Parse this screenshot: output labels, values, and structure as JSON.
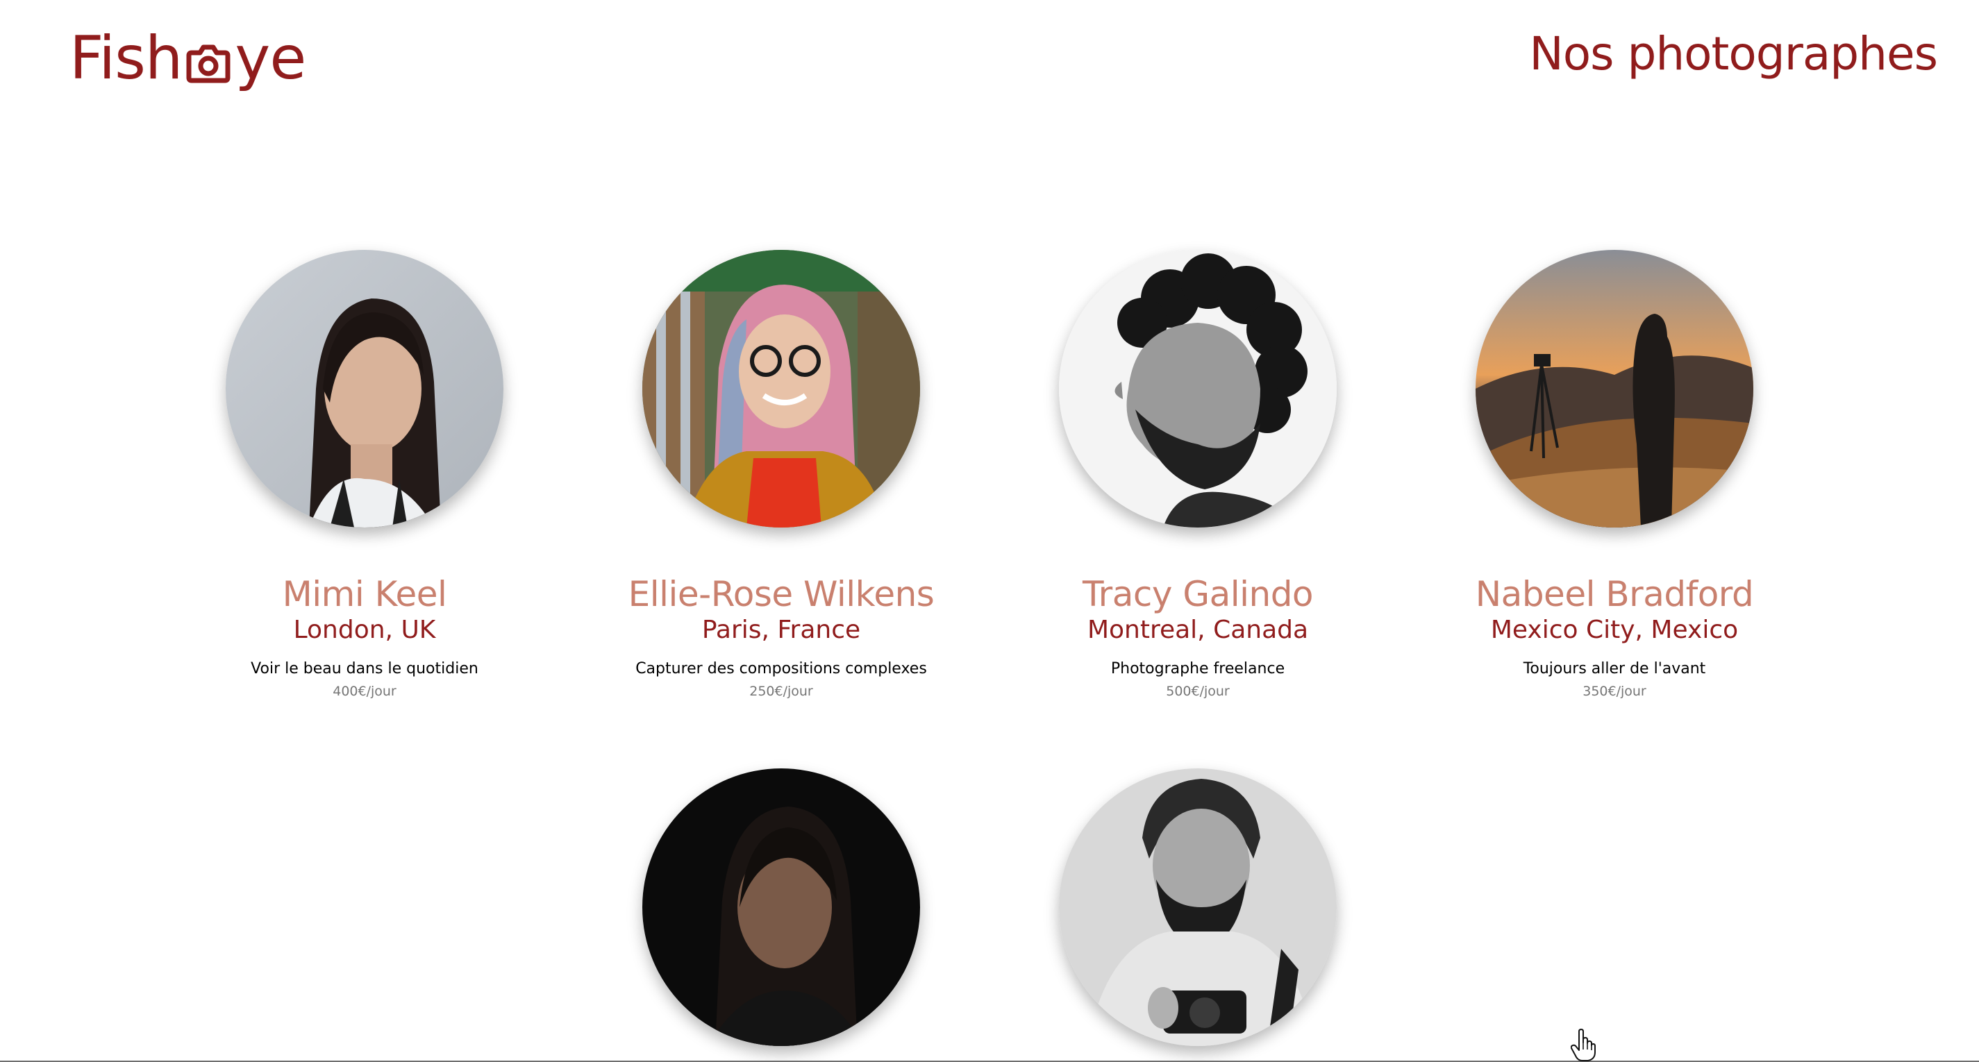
{
  "header": {
    "logo_left": "Fish",
    "logo_right": "ye",
    "logo_icon": "camera-icon",
    "title": "Nos photographes"
  },
  "photographers": [
    {
      "name": "Mimi Keel",
      "location": "London, UK",
      "tagline": "Voir le beau dans le quotidien",
      "price": "400€/jour",
      "portrait_icon": "portrait-photo"
    },
    {
      "name": "Ellie-Rose Wilkens",
      "location": "Paris, France",
      "tagline": "Capturer des compositions complexes",
      "price": "250€/jour",
      "portrait_icon": "portrait-photo"
    },
    {
      "name": "Tracy Galindo",
      "location": "Montreal, Canada",
      "tagline": "Photographe freelance",
      "price": "500€/jour",
      "portrait_icon": "portrait-photo"
    },
    {
      "name": "Nabeel Bradford",
      "location": "Mexico City, Mexico",
      "tagline": "Toujours aller de l'avant",
      "price": "350€/jour",
      "portrait_icon": "portrait-photo"
    },
    {
      "portrait_icon": "portrait-photo"
    },
    {
      "portrait_icon": "portrait-photo"
    }
  ],
  "colors": {
    "brand": "#901C1C",
    "name": "#C9806E",
    "tagline": "#000000",
    "price": "#757575"
  },
  "cursor_icon": "hand-pointer-icon"
}
